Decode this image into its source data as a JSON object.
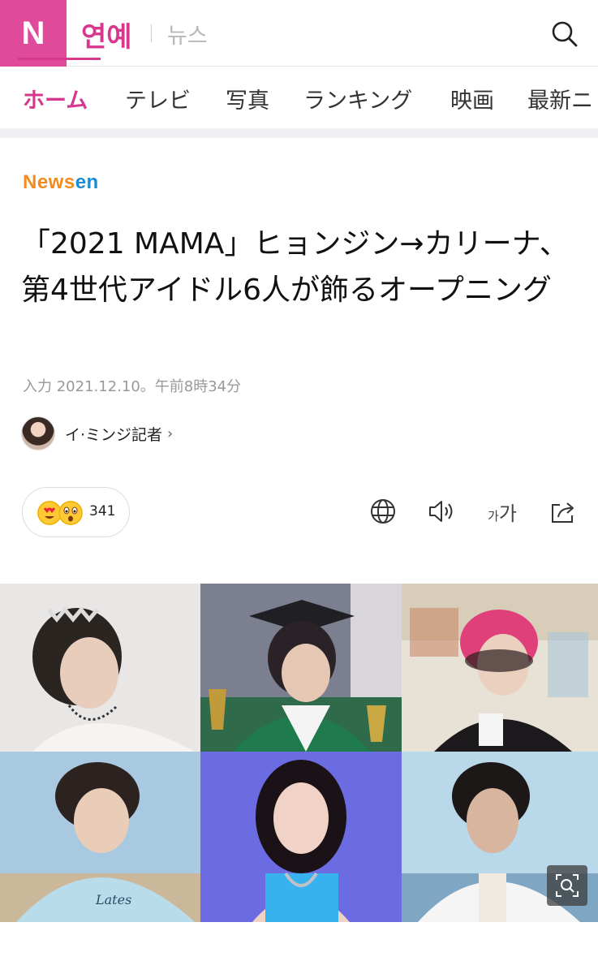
{
  "header": {
    "logo": "N",
    "section": "연예",
    "subsection": "뉴스"
  },
  "tabs": [
    {
      "label": "ホーム",
      "active": true
    },
    {
      "label": "テレビ"
    },
    {
      "label": "写真"
    },
    {
      "label": "ランキング"
    },
    {
      "label": "映画"
    },
    {
      "label": "最新ニ"
    }
  ],
  "article": {
    "source_part1": "News",
    "source_part2": "en",
    "headline": "「2021 MAMA」ヒョンジン→カリーナ、第4世代アイドル6人が飾るオープニング",
    "meta": "入力 2021.12.10。午前8時34分",
    "author": "イ·ミンジ記者"
  },
  "reactions": {
    "count": "341"
  },
  "toolbar": {
    "fontsize_small": "가",
    "fontsize_large": "가"
  },
  "icons": {
    "search": "search-icon",
    "translate": "globe-icon",
    "audio": "speaker-icon",
    "share": "share-icon",
    "zoom": "zoom-icon"
  },
  "colors": {
    "brand": "#e04a9a",
    "accent": "#d6388e",
    "newsen_orange": "#f28c1f",
    "newsen_blue": "#1c8bd6"
  }
}
